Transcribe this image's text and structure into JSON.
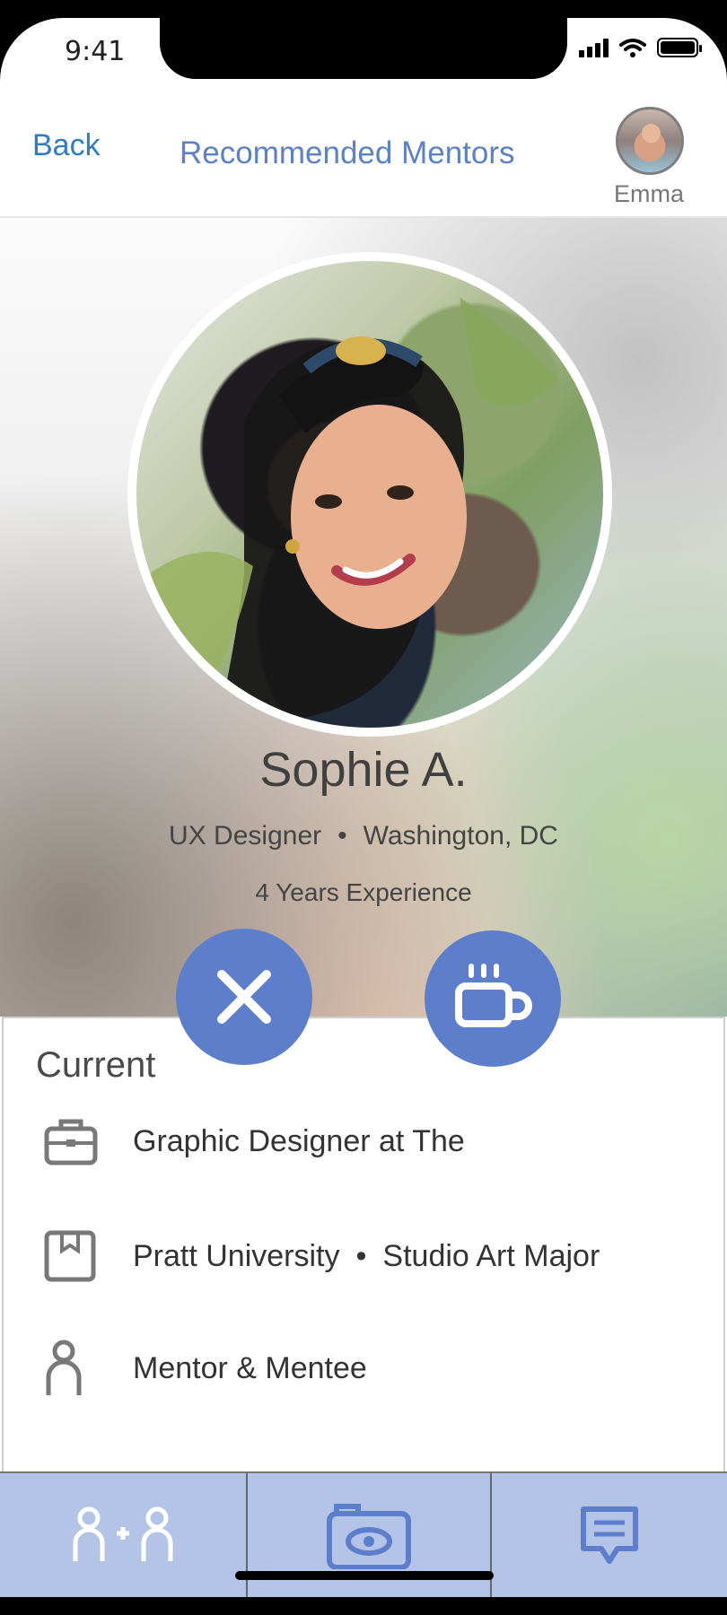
{
  "status_bar": {
    "time": "9:41"
  },
  "header": {
    "back_label": "Back",
    "title": "Recommended Mentors",
    "user_name": "Emma"
  },
  "profile": {
    "name": "Sophie A.",
    "role": "UX Designer",
    "separator": "•",
    "location": "Washington, DC",
    "experience": "4 Years Experience"
  },
  "actions": {
    "dismiss_icon": "close-icon",
    "coffee_icon": "coffee-cup-icon"
  },
  "details": {
    "section_title": "Current",
    "rows": [
      {
        "icon": "briefcase-icon",
        "text": "Graphic Designer at The"
      },
      {
        "icon": "education-icon",
        "text": "Pratt University",
        "extra": "Studio Art Major"
      },
      {
        "icon": "person-icon",
        "text": "Mentor & Mentee"
      }
    ]
  },
  "tab_bar": {
    "tabs": [
      {
        "icon": "connect-users-icon"
      },
      {
        "icon": "camera-eye-icon"
      },
      {
        "icon": "message-icon"
      }
    ]
  },
  "colors": {
    "accent": "#5d7ecb",
    "link": "#2f7bc5",
    "tab_bar": "#b3c4e7"
  }
}
